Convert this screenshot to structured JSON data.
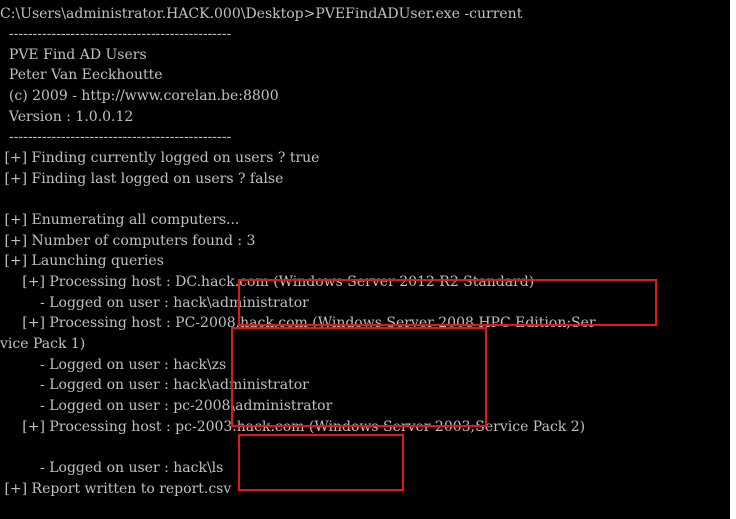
{
  "terminal": {
    "colors": {
      "background": "#000000",
      "text": "#c0c0c0",
      "highlight_border": "#e01818"
    },
    "lines": [
      "C:\\Users\\administrator.HACK.000\\Desktop>PVEFindADUser.exe -current",
      "  -----------------------------------------------",
      "  PVE Find AD Users",
      "  Peter Van Eeckhoutte",
      "  (c) 2009 - http://www.corelan.be:8800",
      "  Version : 1.0.0.12",
      "  -----------------------------------------------",
      " [+] Finding currently logged on users ? true",
      " [+] Finding last logged on users ? false",
      "",
      " [+] Enumerating all computers...",
      " [+] Number of computers found : 3",
      " [+] Launching queries",
      "     [+] Processing host : DC.hack.com (Windows Server 2012 R2 Standard)",
      "         - Logged on user : hack\\administrator",
      "     [+] Processing host : PC-2008.hack.com (Windows Server 2008 HPC Edition;Ser",
      "vice Pack 1)",
      "         - Logged on user : hack\\zs",
      "         - Logged on user : hack\\administrator",
      "         - Logged on user : pc-2008\\administrator",
      "     [+] Processing host : pc-2003.hack.com (Windows Server 2003;Service Pack 2)",
      "",
      "         - Logged on user : hack\\ls",
      " [+] Report written to report.csv"
    ]
  }
}
